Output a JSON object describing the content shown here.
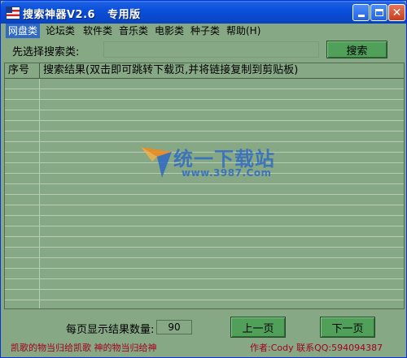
{
  "window": {
    "title": "搜索神器V2.6   专用版"
  },
  "menu": {
    "items": [
      {
        "label": "网盘类",
        "active": true
      },
      {
        "label": "论坛类"
      },
      {
        "label": "软件类"
      },
      {
        "label": "音乐类"
      },
      {
        "label": "电影类"
      },
      {
        "label": "种子类"
      },
      {
        "label": "帮助(H)"
      }
    ]
  },
  "search": {
    "label": "先选择搜索类:",
    "value": "",
    "button_label": "搜索"
  },
  "results": {
    "columns": [
      "序号",
      "搜索结果(双击即可跳转下载页,并将链接复制到剪贴板)"
    ],
    "rows": []
  },
  "watermark": {
    "text": "统一下载站",
    "url": "www.3987.Com"
  },
  "pagination": {
    "per_page_label": "每页显示结果数量:",
    "per_page_value": "90",
    "prev_label": "上一页",
    "next_label": "下一页"
  },
  "footer": {
    "left_text": "凯歌的物当归给凯歌   神的物当归给神",
    "right_text": "作者:Cody   联系QQ:594094387"
  },
  "colors": {
    "titlebar": "#0a50dc",
    "background": "#86a884",
    "button": "#50a05a",
    "footer_text": "#a4001c",
    "menu_active": "#316ac5"
  }
}
